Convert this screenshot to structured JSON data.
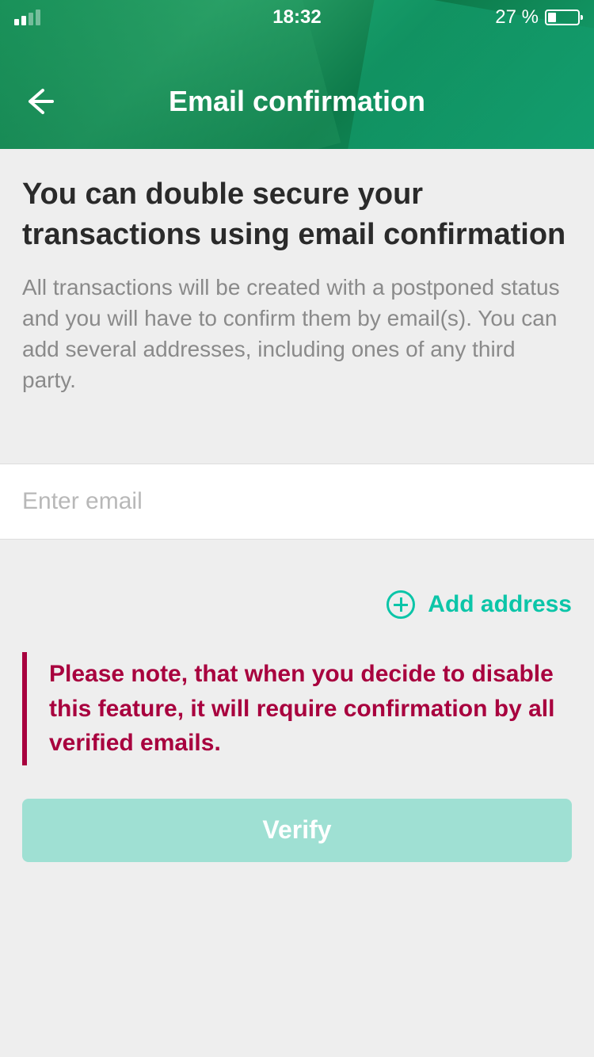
{
  "status_bar": {
    "time": "18:32",
    "battery_percent": "27 %"
  },
  "header": {
    "title": "Email confirmation"
  },
  "content": {
    "heading": "You can double secure your transactions using email confirmation",
    "description": "All transactions will be created with a postponed status and you will have to confirm them by email(s). You can add several addresses, including ones of any third party."
  },
  "input": {
    "placeholder": "Enter email",
    "value": ""
  },
  "add_address_label": "Add address",
  "warning": "Please note, that when you decide to disable this feature, it will require confirmation by all verified emails.",
  "verify_button_label": "Verify",
  "colors": {
    "accent": "#0bc5a8",
    "warning": "#a8003e",
    "button_disabled": "#9fe0d3"
  }
}
